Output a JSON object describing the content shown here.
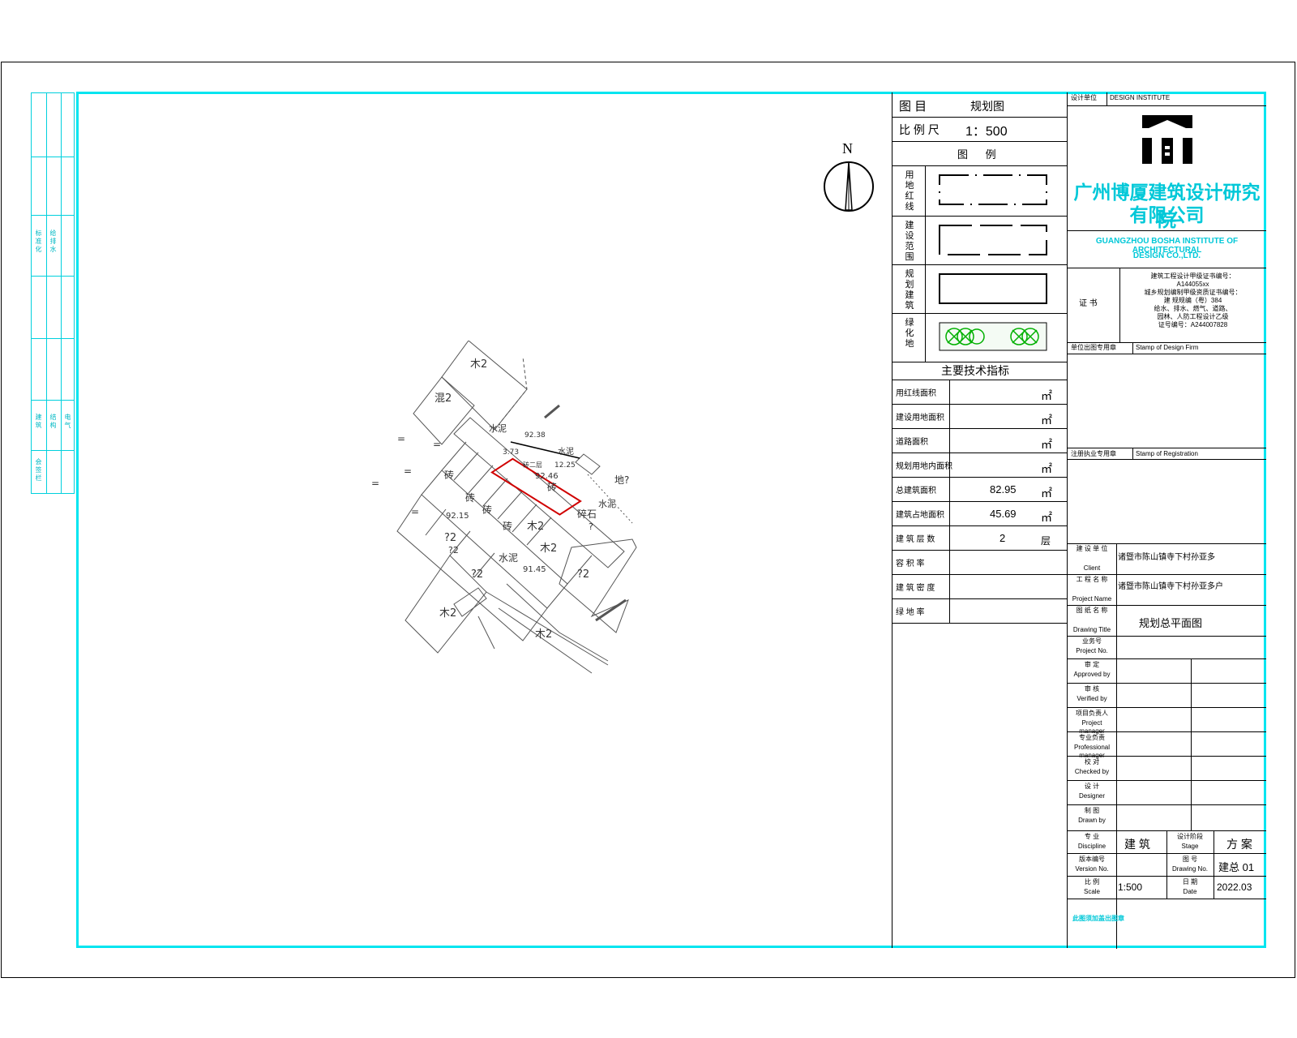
{
  "drawing": {
    "north_label": "N",
    "map_labels": {
      "m1": "木2",
      "m2": "混2",
      "m3": "水泥",
      "m4": "92.38",
      "m5": "3.73",
      "m6": "水泥",
      "m7": "12.25",
      "m8": "砖二层",
      "m9": "92.46",
      "m10": "砖",
      "m11": "地?",
      "m12": "砖",
      "m13": "砖",
      "m14": "砖",
      "m15": "水泥",
      "m16": "92.15",
      "m17": "砖",
      "m18": "木2",
      "m19": "碎石",
      "m20": "?",
      "m21": "?2",
      "m22": "?2",
      "m23": "木2",
      "m24": "水泥",
      "m25": "91.45",
      "m26": "?2",
      "m27": "?2",
      "m28": "木2",
      "m29": "木2",
      "eq1": "=",
      "eq2": "=",
      "eq3": "=",
      "eq4": "=",
      "eq5": "="
    }
  },
  "side_strip": {
    "t1": "标准化",
    "t2": "给排水",
    "t3": "建筑",
    "t4": "结构",
    "t5": "电气",
    "t6": "会签栏"
  },
  "table": {
    "title_label": "图    目",
    "title_value": "规划图",
    "scale_label": "比 例 尺",
    "scale_value": "1：500",
    "legend_title": "图      例",
    "legend_rows": [
      {
        "label": "用地红线"
      },
      {
        "label": "建设范围"
      },
      {
        "label": "规划建筑"
      },
      {
        "label": "绿化地"
      }
    ],
    "indicators_title": "主要技术指标",
    "indicators": [
      {
        "label": "用红线面积",
        "value": "",
        "unit": "㎡"
      },
      {
        "label": "建设用地面积",
        "value": "",
        "unit": "㎡"
      },
      {
        "label": "道路面积",
        "value": "",
        "unit": "㎡"
      },
      {
        "label": "规划用地内面积",
        "value": "",
        "unit": "㎡"
      },
      {
        "label": "总建筑面积",
        "value": "82.95",
        "unit": "㎡"
      },
      {
        "label": "建筑占地面积",
        "value": "45.69",
        "unit": "㎡"
      },
      {
        "label": "建 筑 层 数",
        "value": "2",
        "unit": "层"
      },
      {
        "label": "容 积 率",
        "value": "",
        "unit": ""
      },
      {
        "label": "建 筑 密 度",
        "value": "",
        "unit": ""
      },
      {
        "label": "绿 地 率",
        "value": "",
        "unit": ""
      }
    ]
  },
  "title_block": {
    "design_unit_label": "设计单位",
    "design_unit_value": "DESIGN INSTITUTE",
    "company_cn_1": "广州博厦建筑设计研究院",
    "company_cn_2": "有限公司",
    "company_en_1": "GUANGZHOU BOSHA INSTITUTE OF ARCHITECTURAL",
    "company_en_2": "DESIGN CO.,LTD.",
    "cert_label": "证  书",
    "cert_lines": [
      "建筑工程设计甲级证书编号：",
      "A144055xx",
      "城乡规划编制甲级资质证书编号：",
      "建 规规编（粤）384",
      "给水、排水、燃气、道路、",
      "园林、人防工程设计乙级",
      "证号编号：A244007828"
    ],
    "stamp_design_label": "单位出图专用章",
    "stamp_design_value": "Stamp of Design Firm",
    "stamp_reg_label": "注册执业专用章",
    "stamp_reg_value": "Stamp of Registration",
    "client_label": "建  设 单  位",
    "client_label_en": "Client",
    "client_value": "诸暨市陈山镇寺下村孙亚多",
    "project_label": "工  程 名  称",
    "project_label_en": "Project Name",
    "project_value": "诸暨市陈山镇寺下村孙亚多户",
    "drawing_label": "图  纸 名  称",
    "drawing_label_en": "Drawing Title",
    "drawing_value": "规划总平面图",
    "project_no_label": "业务号",
    "project_no_en": "Project No.",
    "roles": [
      {
        "cn": "审  定",
        "en": "Approved by"
      },
      {
        "cn": "审  核",
        "en": "Verified by"
      },
      {
        "cn": "项目负责人",
        "en": "Project manager"
      },
      {
        "cn": "专业负责",
        "en": "Professional manager"
      },
      {
        "cn": "校  对",
        "en": "Checked by"
      },
      {
        "cn": "设  计",
        "en": "Designer"
      },
      {
        "cn": "制  图",
        "en": "Drawn by"
      }
    ],
    "discipline_label": "专  业",
    "discipline_en": "Discipline",
    "discipline_value": "建 筑",
    "stage_label": "设计阶段",
    "stage_en": "Stage",
    "stage_value": "方 案",
    "version_label": "版本编号",
    "version_en": "Version No.",
    "drawing_no_label": "图  号",
    "drawing_no_en": "Drawing No.",
    "drawing_no_value": "建总 01",
    "scale_label": "比  例",
    "scale_en": "Scale",
    "scale_value": "1:500",
    "date_label": "日  期",
    "date_en": "Date",
    "date_value": "2022.03",
    "footer": "此图须加盖出图章"
  }
}
